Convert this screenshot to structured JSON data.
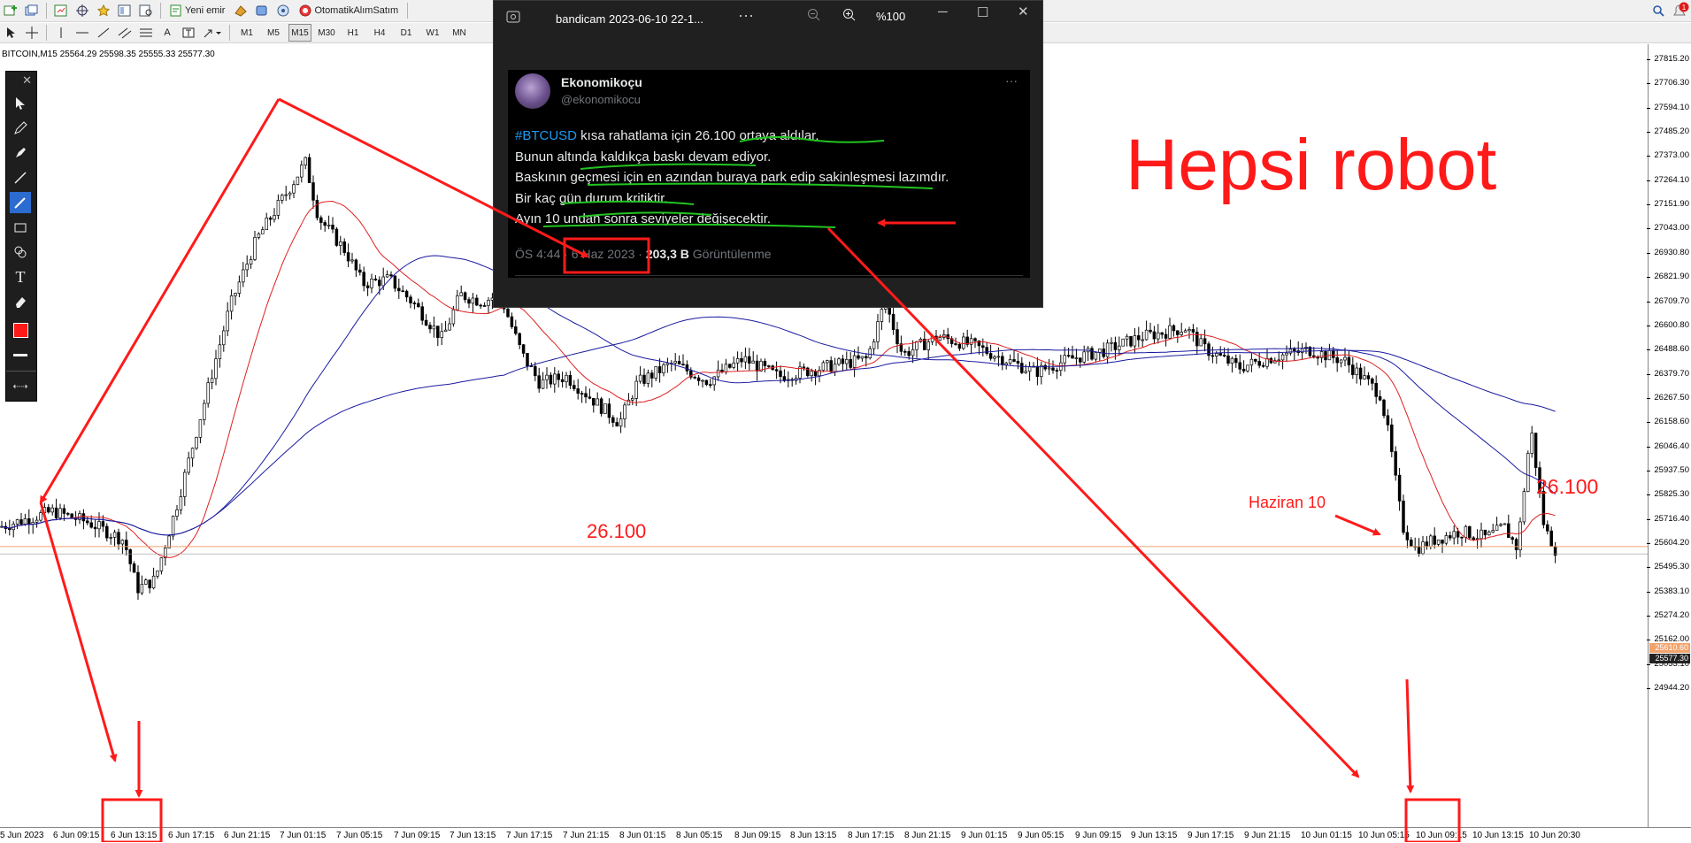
{
  "toolbar1": {
    "new_order": "Yeni emir",
    "auto_trading": "OtomatikAlımSatım",
    "notification_count": "1"
  },
  "toolbar2": {
    "text_tool": "A",
    "timeframes": [
      "M1",
      "M5",
      "M15",
      "M30",
      "H1",
      "H4",
      "D1",
      "W1",
      "MN"
    ],
    "active_timeframe": "M15"
  },
  "symbol_line": "BITCOIN,M15  25564.29 25598.35 25555.33 25577.30",
  "price_labels": [
    "27815.20",
    "27706.30",
    "27594.10",
    "27485.20",
    "27373.00",
    "27264.10",
    "27151.90",
    "27043.00",
    "26930.80",
    "26821.90",
    "26709.70",
    "26600.80",
    "26488.60",
    "26379.70",
    "26267.50",
    "26158.60",
    "26046.40",
    "25937.50",
    "25825.30",
    "25716.40",
    "25604.20",
    "25495.30",
    "25383.10",
    "25274.20",
    "25162.00",
    "25053.10",
    "24944.20"
  ],
  "price_badges": {
    "bid": "25610.60",
    "last": "25577.30"
  },
  "time_labels": [
    "5 Jun 2023",
    "6 Jun 09:15",
    "6 Jun 13:15",
    "6 Jun 17:15",
    "6 Jun 21:15",
    "7 Jun 01:15",
    "7 Jun 05:15",
    "7 Jun 09:15",
    "7 Jun 13:15",
    "7 Jun 17:15",
    "7 Jun 21:15",
    "8 Jun 01:15",
    "8 Jun 05:15",
    "8 Jun 09:15",
    "8 Jun 13:15",
    "8 Jun 17:15",
    "8 Jun 21:15",
    "9 Jun 01:15",
    "9 Jun 05:15",
    "9 Jun 09:15",
    "9 Jun 13:15",
    "9 Jun 17:15",
    "9 Jun 21:15",
    "10 Jun 01:15",
    "10 Jun 05:15",
    "10 Jun 09:15",
    "10 Jun 13:15",
    "10 Jun 20:30"
  ],
  "draw_tools": [
    "cursor-icon",
    "pencil-icon",
    "marker-icon",
    "line-icon",
    "brush-icon",
    "rectangle-icon",
    "shapes-icon",
    "text-icon",
    "eraser-icon",
    "color-swatch-icon",
    "line-width-icon"
  ],
  "draw_text_tool": "T",
  "viewer": {
    "title": "bandicam 2023-06-10 22-1...",
    "zoom": "%100",
    "more": "···"
  },
  "tweet": {
    "name": "Ekonomikoçu",
    "handle": "@ekonomikocu",
    "more": "···",
    "hashtag": "#BTCUSD",
    "line1_rest": " kısa rahatlama için 26.100 ortaya aldılar.",
    "line2": "Bunun altında kaldıkça baskı devam ediyor.",
    "line3": "Baskının geçmesi için en azından buraya park edip sakinleşmesi lazımdır.",
    "line4": "Bir kaç gün durum kritiktir.",
    "line5": "Ayın 10 undan sonra seviyeler değişecektir.",
    "time": "ÖS 4:44 · 6 Haz 2023 ·",
    "views_count": "203,3 B",
    "views_label": "Görüntülenme"
  },
  "annotations": {
    "headline": "Hepsi robot",
    "level_left": "26.100",
    "level_right": "26.100",
    "date_note": "Haziran 10"
  },
  "colors": {
    "annotation": "#ff1a1a",
    "ma_red": "#e02020",
    "ma_blue": "#1a1aa0",
    "twitter_link": "#1d9bf0",
    "highlight_underline": "#22c322",
    "price_line": "#f2a26b"
  }
}
